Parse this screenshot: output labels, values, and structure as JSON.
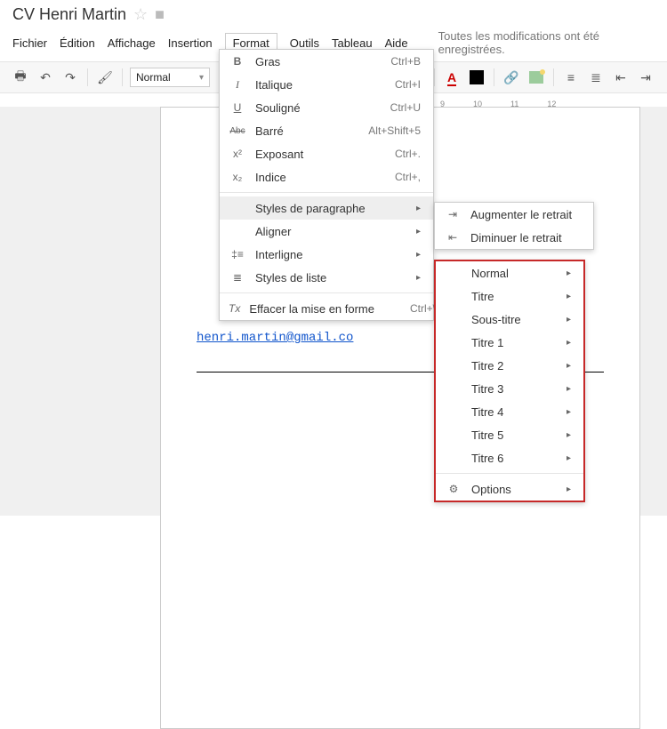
{
  "doc": {
    "title": "CV Henri Martin"
  },
  "save_status": "Toutes les modifications ont été enregistrées.",
  "menubar": {
    "file": "Fichier",
    "edit": "Édition",
    "view": "Affichage",
    "insert": "Insertion",
    "format": "Format",
    "tools": "Outils",
    "table": "Tableau",
    "help": "Aide"
  },
  "toolbar": {
    "style_normal": "Normal"
  },
  "ruler": {
    "t9": "9",
    "t10": "10",
    "t11": "11",
    "t12": "12"
  },
  "page": {
    "email": "henri.martin@gmail.co"
  },
  "format_menu": {
    "bold": {
      "icon": "B",
      "label": "Gras",
      "shortcut": "Ctrl+B"
    },
    "italic": {
      "icon": "I",
      "label": "Italique",
      "shortcut": "Ctrl+I"
    },
    "underline": {
      "icon": "U",
      "label": "Souligné",
      "shortcut": "Ctrl+U"
    },
    "strike": {
      "icon": "Abc",
      "label": "Barré",
      "shortcut": "Alt+Shift+5"
    },
    "super": {
      "icon": "x²",
      "label": "Exposant",
      "shortcut": "Ctrl+."
    },
    "sub": {
      "icon": "x₂",
      "label": "Indice",
      "shortcut": "Ctrl+,"
    },
    "para": {
      "label": "Styles de paragraphe"
    },
    "align": {
      "label": "Aligner"
    },
    "linespace": {
      "label": "Interligne"
    },
    "liststyle": {
      "label": "Styles de liste"
    },
    "clear": {
      "icon": "Tx",
      "label": "Effacer la mise en forme",
      "shortcut": "Ctrl+\\"
    }
  },
  "indent_menu": {
    "increase": "Augmenter le retrait",
    "decrease": "Diminuer le retrait"
  },
  "styles_menu": {
    "normal": "Normal",
    "title": "Titre",
    "subtitle": "Sous-titre",
    "h1": "Titre 1",
    "h2": "Titre 2",
    "h3": "Titre 3",
    "h4": "Titre 4",
    "h5": "Titre 5",
    "h6": "Titre 6",
    "options": "Options"
  }
}
